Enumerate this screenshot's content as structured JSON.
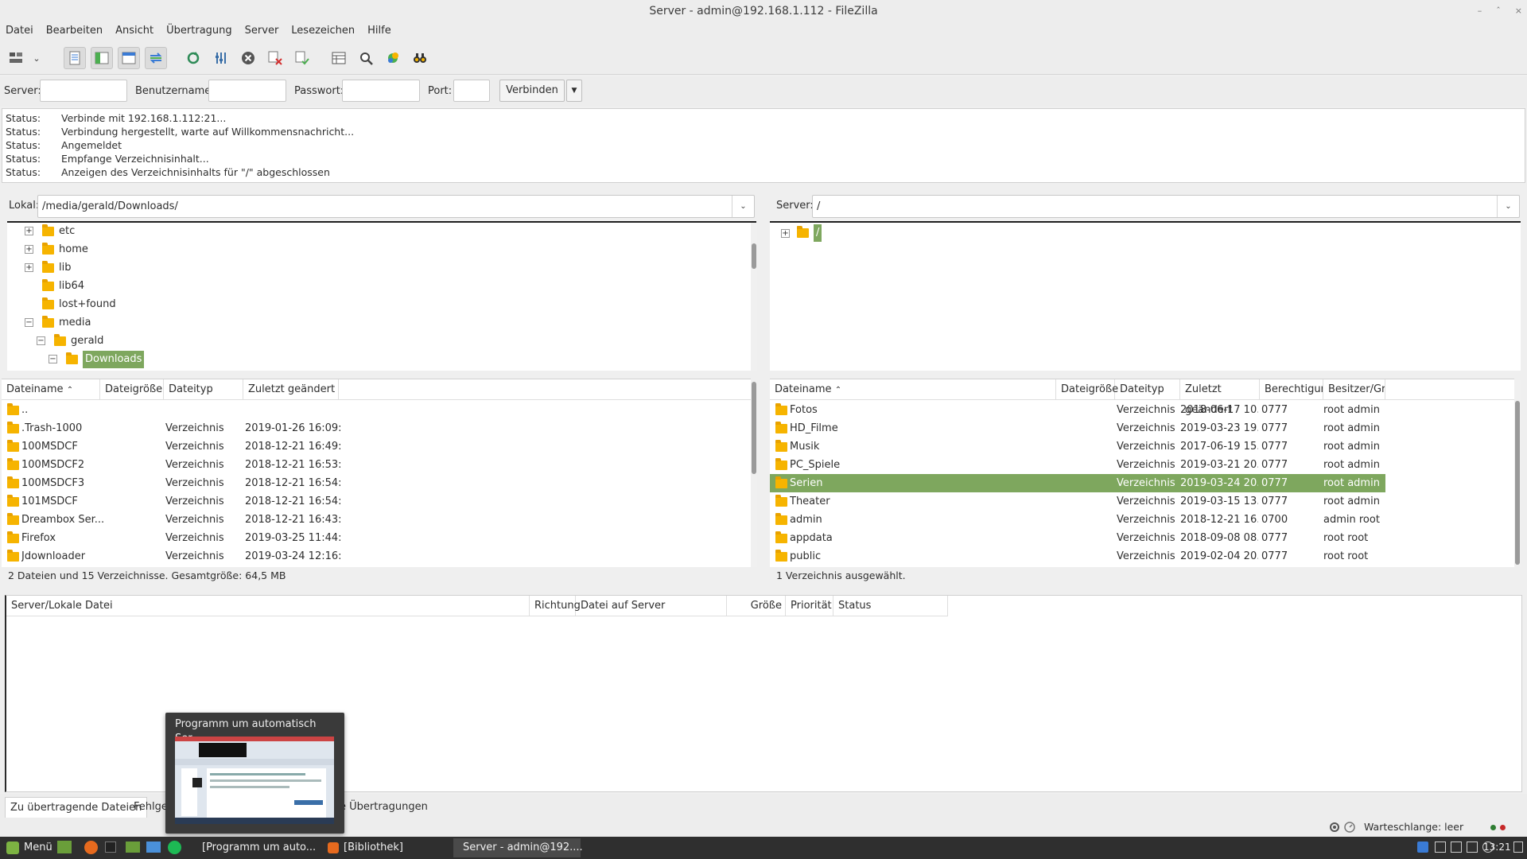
{
  "window": {
    "title": "Server - admin@192.168.1.112 - FileZilla"
  },
  "menu": [
    "Datei",
    "Bearbeiten",
    "Ansicht",
    "Übertragung",
    "Server",
    "Lesezeichen",
    "Hilfe"
  ],
  "quickconnect": {
    "server_label": "Server:",
    "user_label": "Benutzername:",
    "pass_label": "Passwort:",
    "port_label": "Port:",
    "server_value": "",
    "user_value": "",
    "pass_value": "",
    "port_value": "",
    "connect_label": "Verbinden"
  },
  "log": [
    {
      "key": "Status:",
      "msg": "Verbinde mit 192.168.1.112:21..."
    },
    {
      "key": "Status:",
      "msg": "Verbindung hergestellt, warte auf Willkommensnachricht..."
    },
    {
      "key": "Status:",
      "msg": "Angemeldet"
    },
    {
      "key": "Status:",
      "msg": "Empfange Verzeichnisinhalt..."
    },
    {
      "key": "Status:",
      "msg": "Anzeigen des Verzeichnisinhalts für \"/\" abgeschlossen"
    }
  ],
  "local": {
    "label": "Lokal:",
    "path": "/media/gerald/Downloads/",
    "tree": [
      {
        "name": "etc",
        "expander": "+"
      },
      {
        "name": "home",
        "expander": "+"
      },
      {
        "name": "lib",
        "expander": "+"
      },
      {
        "name": "lib64",
        "expander": ""
      },
      {
        "name": "lost+found",
        "expander": ""
      },
      {
        "name": "media",
        "expander": "−"
      },
      {
        "name": "gerald",
        "expander": "−"
      },
      {
        "name": "Downloads",
        "expander": "−"
      }
    ],
    "columns": [
      "Dateiname",
      "Dateigröße",
      "Dateityp",
      "Zuletzt geändert"
    ],
    "files": [
      {
        "name": "..",
        "size": "",
        "type": "",
        "modified": ""
      },
      {
        "name": ".Trash-1000",
        "size": "",
        "type": "Verzeichnis",
        "modified": "2019-01-26 16:09:..."
      },
      {
        "name": "100MSDCF",
        "size": "",
        "type": "Verzeichnis",
        "modified": "2018-12-21 16:49:..."
      },
      {
        "name": "100MSDCF2",
        "size": "",
        "type": "Verzeichnis",
        "modified": "2018-12-21 16:53:..."
      },
      {
        "name": "100MSDCF3",
        "size": "",
        "type": "Verzeichnis",
        "modified": "2018-12-21 16:54:..."
      },
      {
        "name": "101MSDCF",
        "size": "",
        "type": "Verzeichnis",
        "modified": "2018-12-21 16:54:..."
      },
      {
        "name": "Dreambox Ser...",
        "size": "",
        "type": "Verzeichnis",
        "modified": "2018-12-21 16:43:..."
      },
      {
        "name": "Firefox",
        "size": "",
        "type": "Verzeichnis",
        "modified": "2019-03-25 11:44:..."
      },
      {
        "name": "Jdownloader",
        "size": "",
        "type": "Verzeichnis",
        "modified": "2019-03-24 12:16:..."
      }
    ],
    "status": "2 Dateien und 15 Verzeichnisse. Gesamtgröße: 64,5 MB"
  },
  "remote": {
    "label": "Server:",
    "path": "/",
    "tree_root": "/",
    "columns": [
      "Dateiname",
      "Dateigröße",
      "Dateityp",
      "Zuletzt geändert",
      "Berechtigung",
      "Besitzer/Grup"
    ],
    "files": [
      {
        "name": "Fotos",
        "size": "",
        "type": "Verzeichnis",
        "modified": "2018-06-17 10...",
        "perm": "0777",
        "owner": "root admin"
      },
      {
        "name": "HD_Filme",
        "size": "",
        "type": "Verzeichnis",
        "modified": "2019-03-23 19...",
        "perm": "0777",
        "owner": "root admin"
      },
      {
        "name": "Musik",
        "size": "",
        "type": "Verzeichnis",
        "modified": "2017-06-19 15...",
        "perm": "0777",
        "owner": "root admin"
      },
      {
        "name": "PC_Spiele",
        "size": "",
        "type": "Verzeichnis",
        "modified": "2019-03-21 20...",
        "perm": "0777",
        "owner": "root admin"
      },
      {
        "name": "Serien",
        "size": "",
        "type": "Verzeichnis",
        "modified": "2019-03-24 20...",
        "perm": "0777",
        "owner": "root admin",
        "selected": true
      },
      {
        "name": "Theater",
        "size": "",
        "type": "Verzeichnis",
        "modified": "2019-03-15 13...",
        "perm": "0777",
        "owner": "root admin"
      },
      {
        "name": "admin",
        "size": "",
        "type": "Verzeichnis",
        "modified": "2018-12-21 16...",
        "perm": "0700",
        "owner": "admin root"
      },
      {
        "name": "appdata",
        "size": "",
        "type": "Verzeichnis",
        "modified": "2018-09-08 08...",
        "perm": "0777",
        "owner": "root root"
      },
      {
        "name": "public",
        "size": "",
        "type": "Verzeichnis",
        "modified": "2019-02-04 20...",
        "perm": "0777",
        "owner": "root root"
      }
    ],
    "status": "1 Verzeichnis ausgewählt."
  },
  "queue": {
    "columns": [
      "Server/Lokale Datei",
      "Richtung",
      "Datei auf Server",
      "Größe",
      "Priorität",
      "Status"
    ],
    "tabs": [
      "Zu übertragende Dateien",
      "Fehlge",
      "e Übertragungen"
    ],
    "status": "Warteschlange: leer"
  },
  "preview": {
    "title": "Programm um automatisch Ser..."
  },
  "taskbar": {
    "menu_label": "Menü",
    "items": [
      "[Programm um auto...",
      "[Bibliothek]",
      "Server - admin@192...."
    ],
    "clock": "13:21"
  },
  "colors": {
    "selection": "#7ea75e",
    "folder": "#f6b400",
    "taskbar": "#2f2f2f"
  }
}
